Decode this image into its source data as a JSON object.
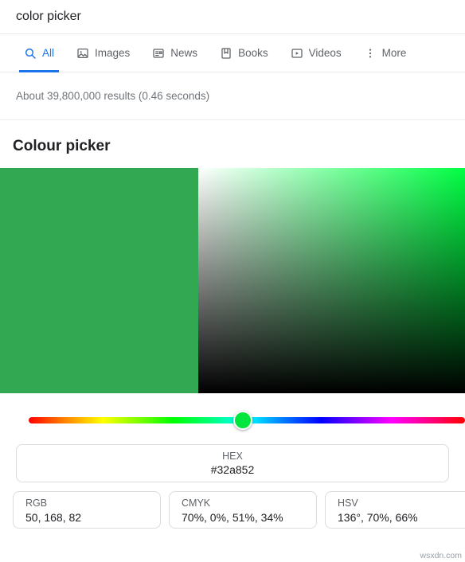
{
  "search": {
    "query": "color picker"
  },
  "tabs": [
    {
      "label": "All",
      "icon": "search-icon",
      "active": true
    },
    {
      "label": "Images",
      "icon": "image-icon",
      "active": false
    },
    {
      "label": "News",
      "icon": "news-icon",
      "active": false
    },
    {
      "label": "Books",
      "icon": "book-icon",
      "active": false
    },
    {
      "label": "Videos",
      "icon": "video-icon",
      "active": false
    },
    {
      "label": "More",
      "icon": "kebab-menu-icon",
      "active": false
    }
  ],
  "result_stats": "About 39,800,000 results (0.46 seconds)",
  "widget": {
    "title": "Colour picker",
    "selected_color": "#32a852",
    "hue_degrees": 136,
    "hue_knob_percent": 49,
    "hex": {
      "label": "HEX",
      "value": "#32a852"
    },
    "fields": [
      {
        "label": "RGB",
        "value": "50, 168, 82"
      },
      {
        "label": "CMYK",
        "value": "70%, 0%, 51%, 34%"
      },
      {
        "label": "HSV",
        "value": "136°, 70%, 66%"
      }
    ]
  },
  "watermark": "wsxdn.com"
}
